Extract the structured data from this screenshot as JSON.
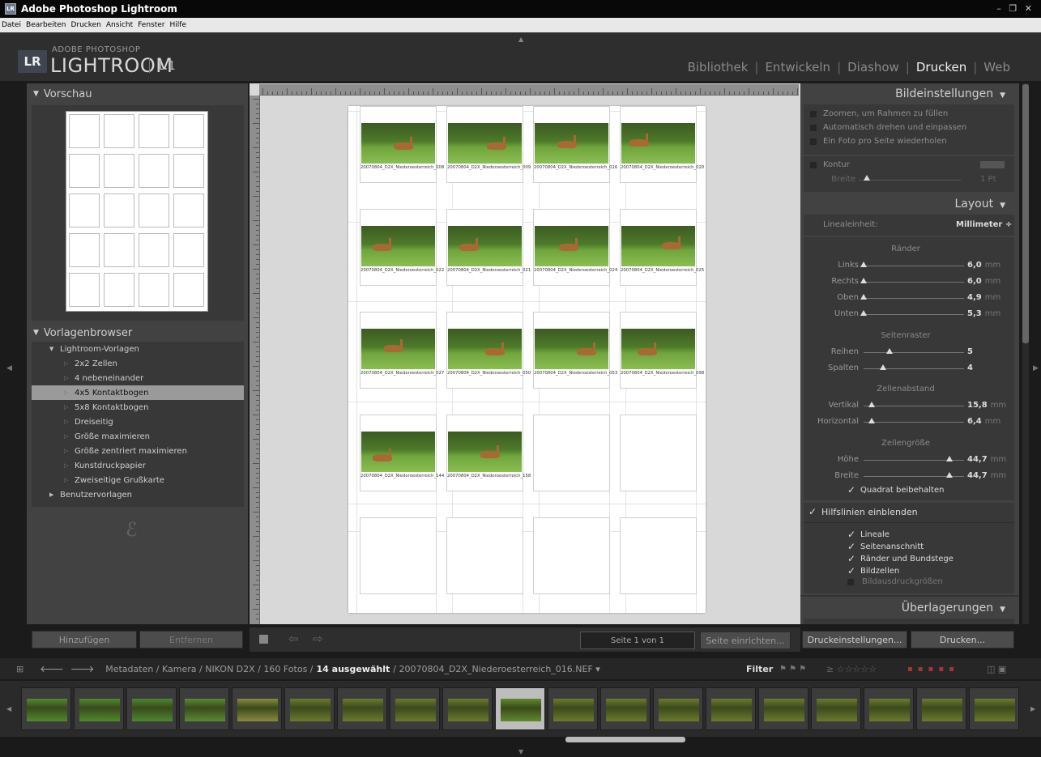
{
  "window": {
    "title": "Adobe Photoshop Lightroom",
    "controls": "– ❐ ✕"
  },
  "menu": [
    "Datei",
    "Bearbeiten",
    "Drucken",
    "Ansicht",
    "Fenster",
    "Hilfe"
  ],
  "logo": {
    "badge": "LR",
    "sub": "ADOBE PHOTOSHOP",
    "main": "LIGHTROOM",
    "version": "1.1"
  },
  "modules": [
    {
      "label": "Bibliothek",
      "active": false
    },
    {
      "label": "Entwickeln",
      "active": false
    },
    {
      "label": "Diashow",
      "active": false
    },
    {
      "label": "Drucken",
      "active": true
    },
    {
      "label": "Web",
      "active": false
    }
  ],
  "left": {
    "preview_title": "Vorschau",
    "templates_title": "Vorlagenbrowser",
    "folder_lightroom": "Lightroom-Vorlagen",
    "templates": [
      "2x2 Zellen",
      "4 nebeneinander",
      "4x5 Kontaktbogen",
      "5x8 Kontaktbogen",
      "Dreiseitig",
      "Größe maximieren",
      "Größe zentriert maximieren",
      "Kunstdruckpapier",
      "Zweiseitige Grußkarte"
    ],
    "selected_template": "4x5 Kontaktbogen",
    "folder_user": "Benutzervorlagen",
    "add_button": "Hinzufügen",
    "remove_button": "Entfernen"
  },
  "page_cells": [
    {
      "caption": "20070804_D2X_Niederoesterreich_008"
    },
    {
      "caption": "20070804_D2X_Niederoesterreich_009"
    },
    {
      "caption": "20070804_D2X_Niederoesterreich_016"
    },
    {
      "caption": "20070804_D2X_Niederoesterreich_020"
    },
    {
      "caption": "20070804_D2X_Niederoesterreich_022"
    },
    {
      "caption": "20070804_D2X_Niederoesterreich_021"
    },
    {
      "caption": "20070804_D2X_Niederoesterreich_024"
    },
    {
      "caption": "20070804_D2X_Niederoesterreich_025"
    },
    {
      "caption": "20070804_D2X_Niederoesterreich_027"
    },
    {
      "caption": "20070804_D2X_Niederoesterreich_050"
    },
    {
      "caption": "20070804_D2X_Niederoesterreich_053"
    },
    {
      "caption": "20070804_D2X_Niederoesterreich_098"
    },
    {
      "caption": "20070804_D2X_Niederoesterreich_144"
    },
    {
      "caption": "20070804_D2X_Niederoesterreich_158"
    }
  ],
  "center_bar": {
    "page_info": "Seite 1 von 1",
    "page_setup_button": "Seite einrichten...",
    "prev_icon": "arrow-left-icon",
    "next_icon": "arrow-right-icon"
  },
  "right": {
    "image_settings": {
      "title": "Bildeinstellungen",
      "options": [
        {
          "label": "Zoomen, um Rahmen zu füllen",
          "checked": false
        },
        {
          "label": "Automatisch drehen und einpassen",
          "checked": false
        },
        {
          "label": "Ein Foto pro Seite wiederholen",
          "checked": false
        }
      ],
      "stroke_label": "Kontur",
      "width_label": "Breite",
      "width_value": "1 Pt"
    },
    "layout": {
      "title": "Layout",
      "ruler_unit_label": "Linealeinheit:",
      "ruler_unit_value": "Millimeter ÷",
      "margins_title": "Ränder",
      "margins": [
        {
          "label": "Links",
          "value": "6,0",
          "unit": "mm",
          "level": 0.0
        },
        {
          "label": "Rechts",
          "value": "6,0",
          "unit": "mm",
          "level": 0.0
        },
        {
          "label": "Oben",
          "value": "4,9",
          "unit": "mm",
          "level": 0.0
        },
        {
          "label": "Unten",
          "value": "5,3",
          "unit": "mm",
          "level": 0.0
        }
      ],
      "grid_title": "Seitenraster",
      "grid": [
        {
          "label": "Reihen",
          "value": "5",
          "level": 0.27
        },
        {
          "label": "Spalten",
          "value": "4",
          "level": 0.2
        }
      ],
      "spacing_title": "Zellenabstand",
      "spacing": [
        {
          "label": "Vertikal",
          "value": "15,8",
          "unit": "mm",
          "level": 0.08
        },
        {
          "label": "Horizontal",
          "value": "6,4",
          "unit": "mm",
          "level": 0.08
        }
      ],
      "size_title": "Zellengröße",
      "size": [
        {
          "label": "Höhe",
          "value": "44,7",
          "unit": "mm",
          "level": 0.88
        },
        {
          "label": "Breite",
          "value": "44,7",
          "unit": "mm",
          "level": 0.88
        }
      ],
      "keep_square": "Quadrat beibehalten"
    },
    "guides": {
      "title": "Hilfslinien einblenden",
      "items": [
        {
          "label": "Lineale",
          "checked": true
        },
        {
          "label": "Seitenanschnitt",
          "checked": true
        },
        {
          "label": "Ränder und Bundstege",
          "checked": true
        },
        {
          "label": "Bildzellen",
          "checked": true
        },
        {
          "label": "Bildausdruckgrößen",
          "checked": false
        }
      ]
    },
    "overlays_title": "Überlagerungen",
    "print_settings_button": "Druckeinstellungen...",
    "print_button": "Drucken..."
  },
  "filmstrip_bar": {
    "path": "Metadaten / Kamera / NIKON D2X / 160 Fotos /",
    "selected": "14 ausgewählt",
    "file": "/ 20070804_D2X_Niederoesterreich_016.NEF ▾",
    "filter_label": "Filter"
  },
  "colors": {
    "accent_active": "#f0f0f0",
    "panel": "#424242",
    "page": "#ffffff"
  }
}
